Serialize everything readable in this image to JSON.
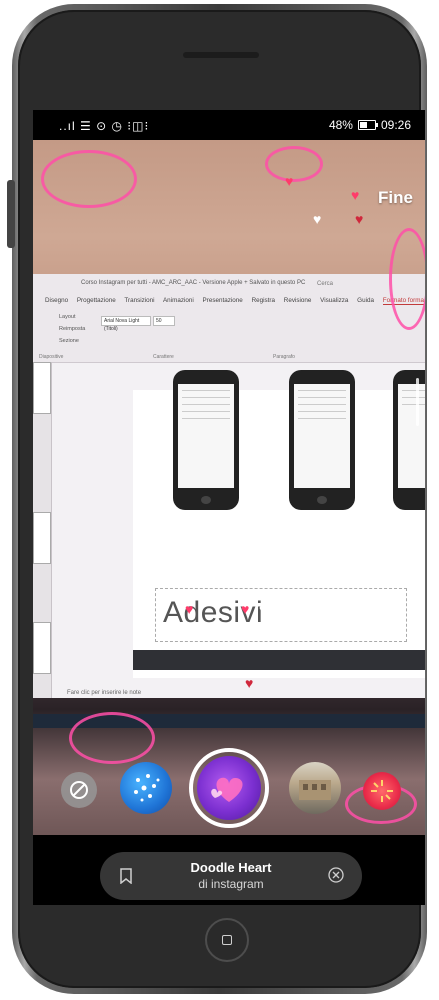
{
  "status_bar": {
    "left_icons": "..ıl ☰ ⊙ ◷ ⁝◫⁝",
    "battery_percent": "48%",
    "time": "09:26"
  },
  "camera_view": {
    "done_label": "Fine",
    "slide_title": "Adesivi",
    "ribbon": {
      "window_title": "Corso Instagram per tutti - AMC_ARC_AAC - Versione Apple + Salvato in questo PC",
      "search": "Cerca",
      "tabs": [
        "Disegno",
        "Progettazione",
        "Transizioni",
        "Animazioni",
        "Presentazione",
        "Registra",
        "Revisione",
        "Visualizza",
        "Guida",
        "Formato forma"
      ],
      "active_tab": "Formato forma",
      "font_name": "Arial Nova Light (Titoli)",
      "font_size": "50",
      "tools": [
        "Layout",
        "Reimposta",
        "Sezione",
        "Diapositive",
        "Carattere",
        "Paragrafo"
      ]
    },
    "notes_placeholder": "Fare clic per inserire le note"
  },
  "effects": {
    "items": [
      {
        "name": "no-effect",
        "icon": "no-effect-icon"
      },
      {
        "name": "sparkle",
        "icon": "sparkle-icon"
      },
      {
        "name": "doodle-heart",
        "icon": "doodle-heart-icon",
        "selected": true
      },
      {
        "name": "photo-filter",
        "icon": "photo-icon"
      },
      {
        "name": "red-flash",
        "icon": "flash-icon"
      }
    ],
    "selected_effect": {
      "name": "Doodle Heart",
      "author": "di instagram"
    }
  },
  "colors": {
    "doodle_pink": "#ff4fa8",
    "selected_ring": "#ffffff",
    "info_pill": "#3c3c3c"
  }
}
